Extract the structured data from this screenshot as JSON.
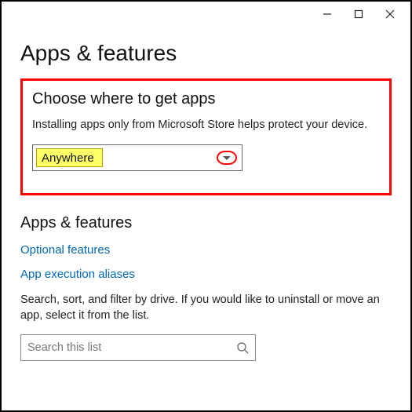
{
  "page": {
    "title": "Apps & features"
  },
  "choose_section": {
    "heading": "Choose where to get apps",
    "description": "Installing apps only from Microsoft Store helps protect your device.",
    "dropdown": {
      "selected": "Anywhere"
    }
  },
  "apps_section": {
    "heading": "Apps & features",
    "link_optional": "Optional features",
    "link_aliases": "App execution aliases",
    "body": "Search, sort, and filter by drive. If you would like to uninstall or move an app, select it from the list.",
    "search_placeholder": "Search this list"
  }
}
